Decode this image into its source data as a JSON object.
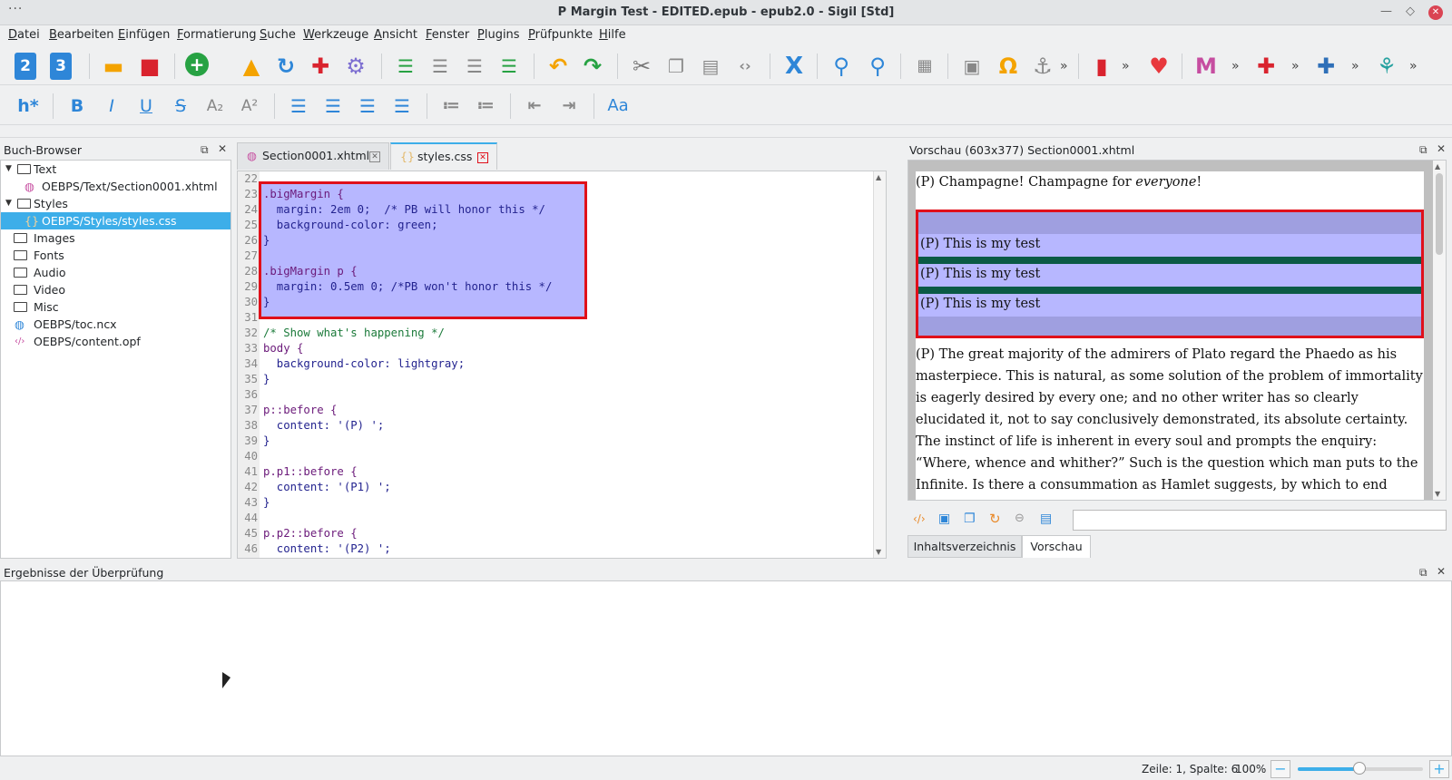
{
  "window": {
    "title": "P Margin Test - EDITED.epub - epub2.0 - Sigil [Std]",
    "menu_dots": "···"
  },
  "menu": [
    "Datei",
    "Bearbeiten",
    "Einfügen",
    "Formatierung",
    "Suche",
    "Werkzeuge",
    "Ansicht",
    "Fenster",
    "Plugins",
    "Prüfpunkte",
    "Hilfe"
  ],
  "toolbar2": {
    "heading": "h*",
    "bold": "B",
    "italic": "I",
    "underline": "U",
    "strike": "S",
    "case": "Aa"
  },
  "colors": {
    "accent": "#3daee9",
    "highlight_border": "#e0101a",
    "highlight_fill": "#b7b7ff"
  },
  "book_browser": {
    "title": "Buch-Browser",
    "items": [
      {
        "label": "Text",
        "type": "folder",
        "expanded": true
      },
      {
        "label": "OEBPS/Text/Section0001.xhtml",
        "type": "xhtml"
      },
      {
        "label": "Styles",
        "type": "folder",
        "expanded": true
      },
      {
        "label": "OEBPS/Styles/styles.css",
        "type": "css",
        "selected": true
      },
      {
        "label": "Images",
        "type": "folder"
      },
      {
        "label": "Fonts",
        "type": "folder"
      },
      {
        "label": "Audio",
        "type": "folder"
      },
      {
        "label": "Video",
        "type": "folder"
      },
      {
        "label": "Misc",
        "type": "folder"
      },
      {
        "label": "OEBPS/toc.ncx",
        "type": "ncx"
      },
      {
        "label": "OEBPS/content.opf",
        "type": "opf"
      }
    ]
  },
  "tabs": [
    {
      "label": "Section0001.xhtml",
      "active": false
    },
    {
      "label": "styles.css",
      "active": true
    }
  ],
  "editor": {
    "lines": [
      {
        "n": "22",
        "text": ""
      },
      {
        "n": "23",
        "text": ".bigMargin {"
      },
      {
        "n": "24",
        "text": "  margin: 2em 0;  /* PB will honor this */"
      },
      {
        "n": "25",
        "text": "  background-color: green;"
      },
      {
        "n": "26",
        "text": "}"
      },
      {
        "n": "27",
        "text": ""
      },
      {
        "n": "28",
        "text": ".bigMargin p {"
      },
      {
        "n": "29",
        "text": "  margin: 0.5em 0; /*PB won't honor this */"
      },
      {
        "n": "30",
        "text": "}"
      },
      {
        "n": "31",
        "text": ""
      },
      {
        "n": "32",
        "text": "/* Show what's happening */"
      },
      {
        "n": "33",
        "text": "body {"
      },
      {
        "n": "34",
        "text": "  background-color: lightgray;"
      },
      {
        "n": "35",
        "text": "}"
      },
      {
        "n": "36",
        "text": ""
      },
      {
        "n": "37",
        "text": "p::before {"
      },
      {
        "n": "38",
        "text": "  content: '(P) ';"
      },
      {
        "n": "39",
        "text": "}"
      },
      {
        "n": "40",
        "text": ""
      },
      {
        "n": "41",
        "text": "p.p1::before {"
      },
      {
        "n": "42",
        "text": "  content: '(P1) ';"
      },
      {
        "n": "43",
        "text": "}"
      },
      {
        "n": "44",
        "text": ""
      },
      {
        "n": "45",
        "text": "p.p2::before {"
      },
      {
        "n": "46",
        "text": "  content: '(P2) ';"
      }
    ]
  },
  "preview": {
    "title": "Vorschau (603x377) Section0001.xhtml",
    "first_line_pre": "(P) Champagne! Champagne for ",
    "first_line_em": "everyone",
    "first_line_post": "!",
    "test_lines": [
      "(P) This is my test",
      "(P) This is my test",
      "(P) This is my test"
    ],
    "paragraph": "(P) The great majority of the admirers of Plato regard the Phaedo as his masterpiece. This is natural, as some solution of the problem of immortality is eagerly desired by every one; and no other writer has so clearly elucidated it, not to say conclusively demonstrated, its absolute certainty. The instinct of life is inherent in every soul and prompts the enquiry: “Where, whence and whither?” Such is the question which man puts to the Infinite. Is there a consummation as Hamlet suggests, by which to end every heart-ache, untoward fortune or calamity — a sleep when “we",
    "search_value": "",
    "bottom_tabs": [
      {
        "label": "Inhaltsverzeichnis",
        "active": false
      },
      {
        "label": "Vorschau",
        "active": true
      }
    ]
  },
  "results": {
    "title": "Ergebnisse der Überprüfung"
  },
  "status": {
    "position": "Zeile: 1, Spalte: 6",
    "zoom": "100%",
    "zoom_minus": "−",
    "zoom_plus": "+",
    "zoom_fraction": 0.49
  }
}
